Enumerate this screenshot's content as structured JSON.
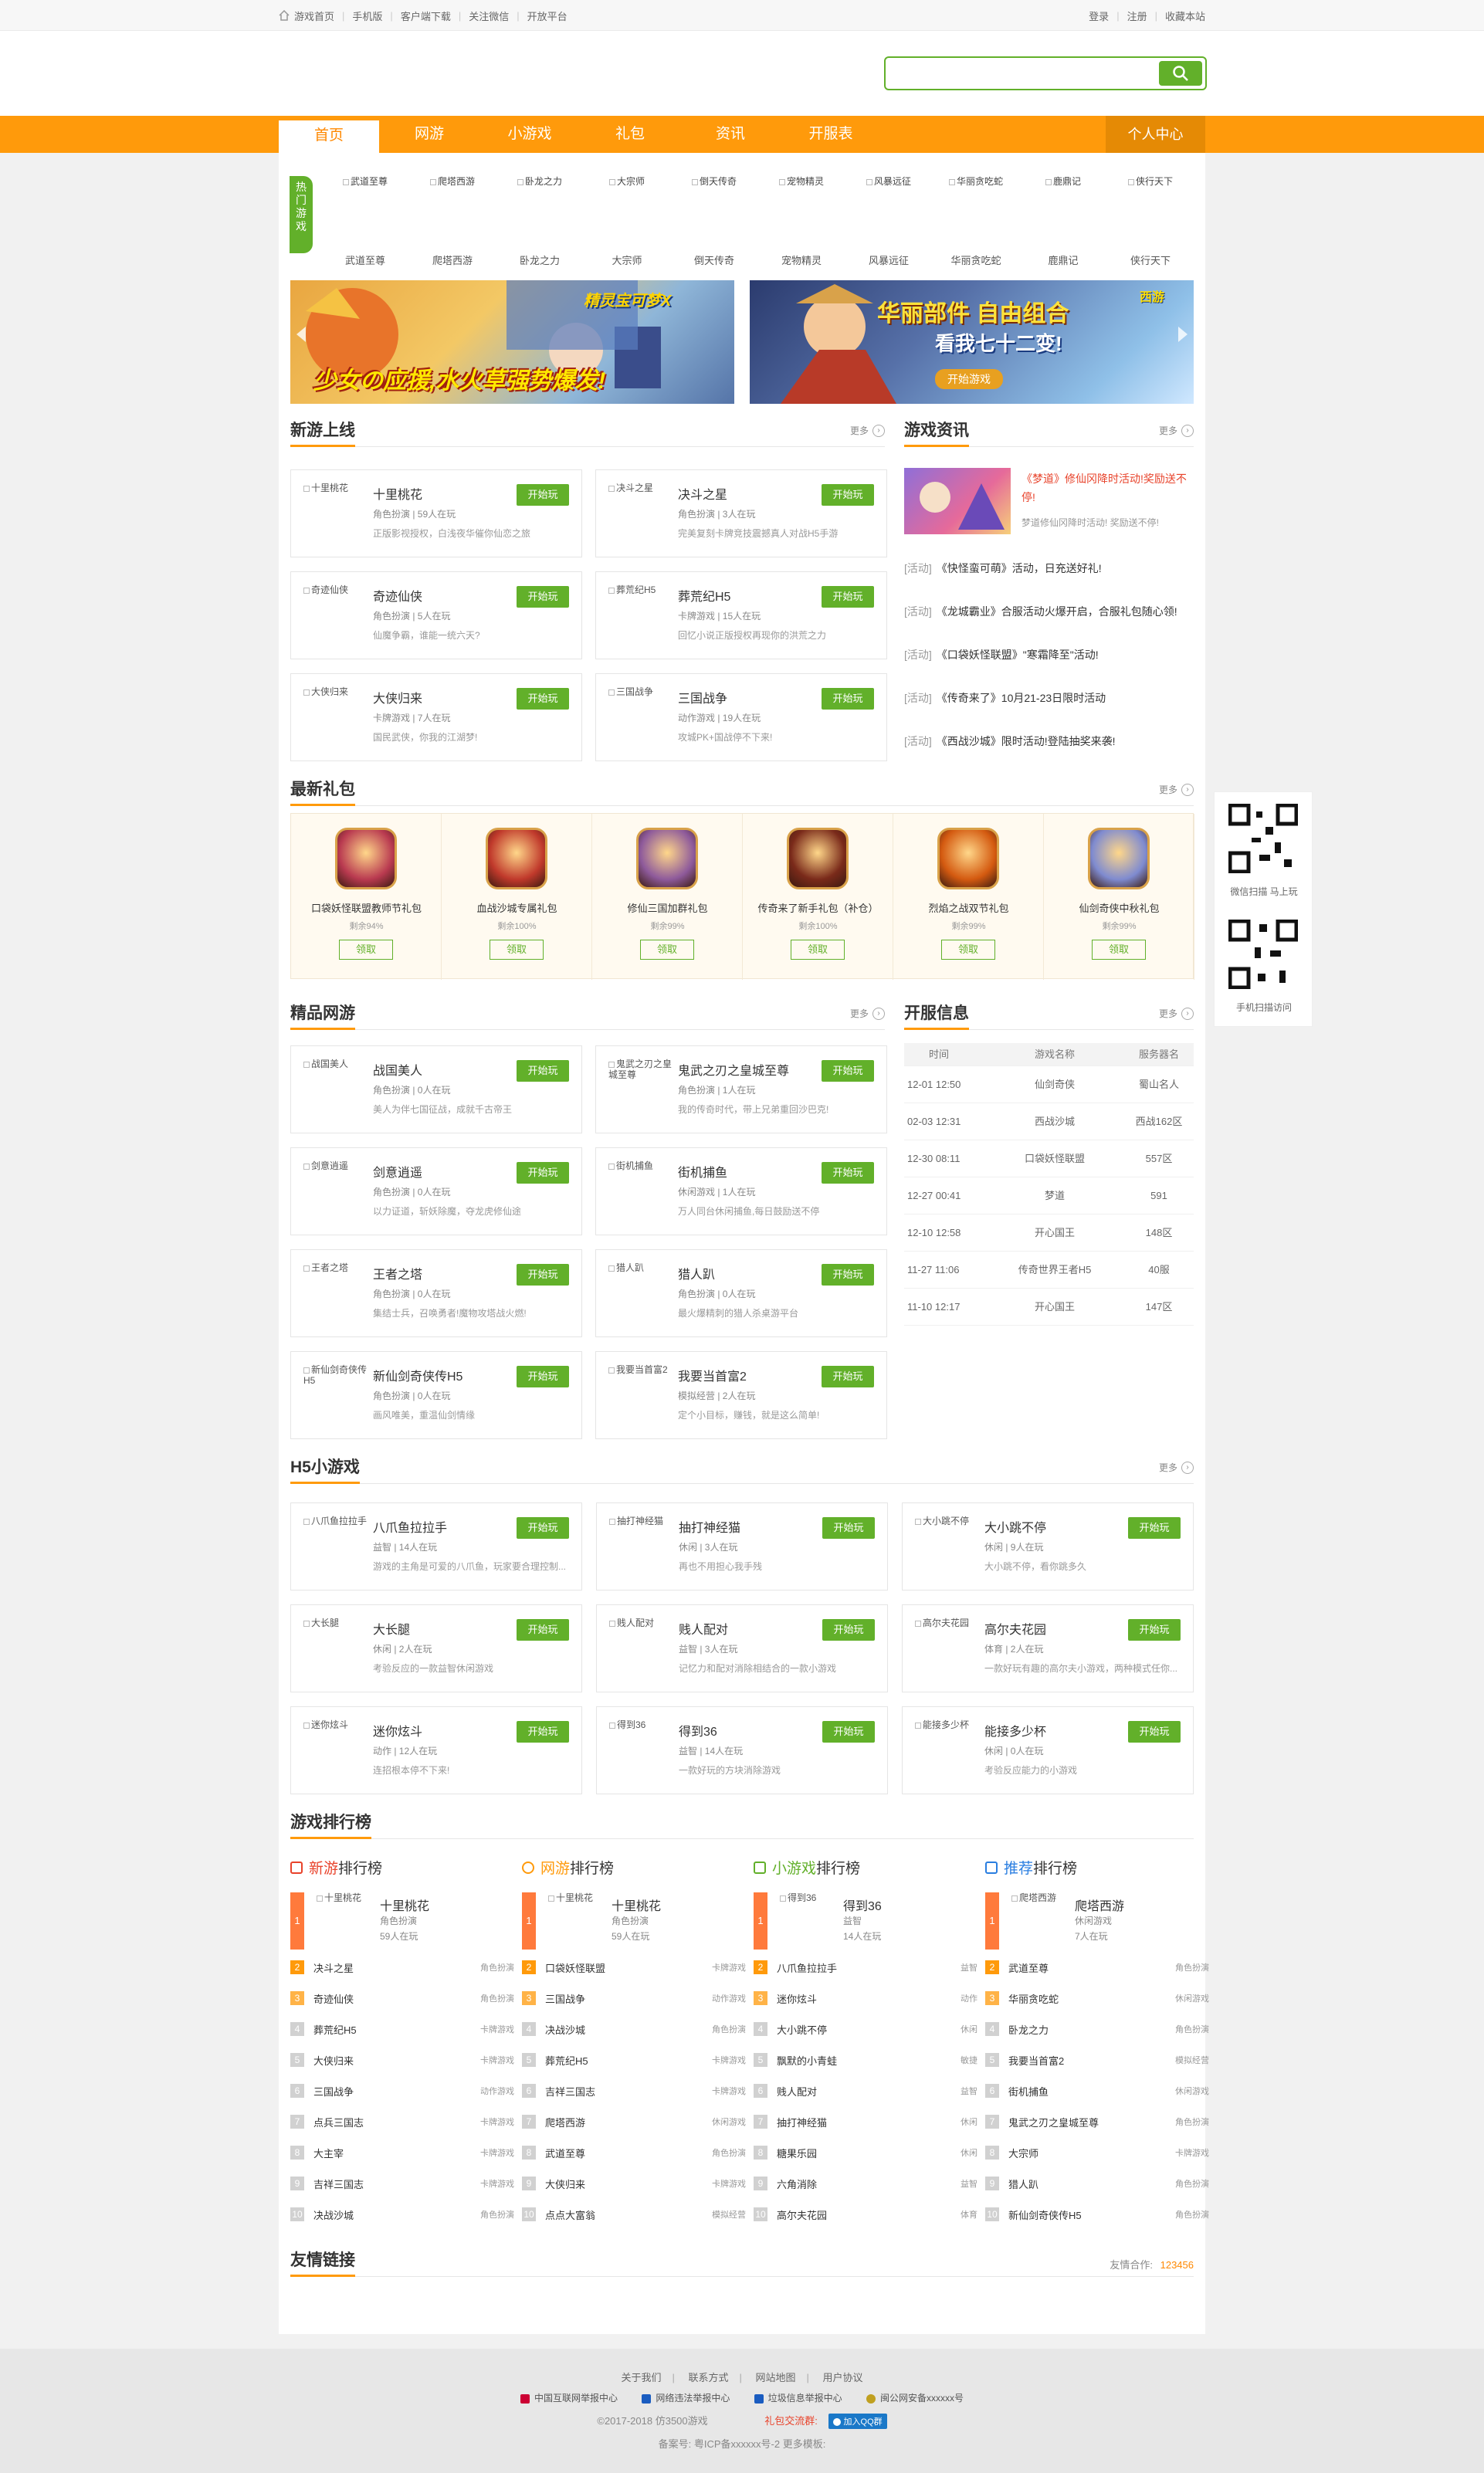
{
  "topbar": {
    "links": [
      "游戏首页",
      "手机版",
      "客户端下载",
      "关注微信",
      "开放平台"
    ],
    "right": [
      "登录",
      "注册",
      "收藏本站"
    ]
  },
  "nav": {
    "items": [
      "首页",
      "网游",
      "小游戏",
      "礼包",
      "资讯",
      "开服表"
    ],
    "user_center": "个人中心"
  },
  "hot": {
    "label": "热门游戏",
    "games": [
      {
        "img": "武道至尊",
        "name": "武道至尊"
      },
      {
        "img": "爬塔西游",
        "name": "爬塔西游"
      },
      {
        "img": "卧龙之力",
        "name": "卧龙之力"
      },
      {
        "img": "大宗师",
        "name": "大宗师"
      },
      {
        "img": "倒天传奇",
        "name": "倒天传奇"
      },
      {
        "img": "宠物精灵",
        "name": "宠物精灵"
      },
      {
        "img": "风暴远征",
        "name": "风暴远征"
      },
      {
        "img": "华丽贪吃蛇",
        "name": "华丽贪吃蛇"
      },
      {
        "img": "鹿鼎记",
        "name": "鹿鼎记"
      },
      {
        "img": "侠行天下",
        "name": "侠行天下"
      }
    ]
  },
  "banners": {
    "left_title": "少女の应援,水火草强势爆发!",
    "left_logo": "精灵宝可梦X",
    "right_title": "华丽部件 自由组合",
    "right_sub": "看我七十二变!",
    "right_btn": "开始游戏",
    "right_logo": "西游"
  },
  "sections": {
    "new_games": "新游上线",
    "news": "游戏资讯",
    "gifts": "最新礼包",
    "boutique": "精品网游",
    "servers": "开服信息",
    "h5": "H5小游戏",
    "ranking": "游戏排行榜",
    "links": "友情链接",
    "more": "更多"
  },
  "play_label": "开始玩",
  "new_games": [
    {
      "img": "十里桃花",
      "name": "十里桃花",
      "meta": "角色扮演 | 59人在玩",
      "desc": "正版影视授权，白浅夜华催你仙恋之旅"
    },
    {
      "img": "决斗之星",
      "name": "决斗之星",
      "meta": "角色扮演 | 3人在玩",
      "desc": "完美复刻卡牌竞技震撼真人对战H5手游"
    },
    {
      "img": "奇迹仙侠",
      "name": "奇迹仙侠",
      "meta": "角色扮演 | 5人在玩",
      "desc": "仙魔争霸，谁能一统六天?"
    },
    {
      "img": "葬荒纪H5",
      "name": "葬荒纪H5",
      "meta": "卡牌游戏 | 15人在玩",
      "desc": "回忆小说正版授权再现你的洪荒之力"
    },
    {
      "img": "大侠归来",
      "name": "大侠归来",
      "meta": "卡牌游戏 | 7人在玩",
      "desc": "国民武侠，你我的江湖梦!"
    },
    {
      "img": "三国战争",
      "name": "三国战争",
      "meta": "动作游戏 | 19人在玩",
      "desc": "攻城PK+国战停不下来!"
    }
  ],
  "news_top": {
    "title": "《梦道》修仙冈降时活动!奖励送不停!",
    "desc": "梦道修仙冈降时活动! 奖励送不停!"
  },
  "news_list": [
    {
      "tag": "[活动]",
      "title": "《快怪蛮可萌》活动，日充送好礼!"
    },
    {
      "tag": "[活动]",
      "title": "《龙城霸业》合服活动火爆开启，合服礼包随心领!"
    },
    {
      "tag": "[活动]",
      "title": "《口袋妖怪联盟》\"寒霜降至\"活动!"
    },
    {
      "tag": "[活动]",
      "title": "《传奇来了》10月21-23日限时活动"
    },
    {
      "tag": "[活动]",
      "title": "《西战沙城》限时活动!登陆抽奖来袭!"
    }
  ],
  "gifts": [
    {
      "name": "口袋妖怪联盟教师节礼包",
      "pct": "剩余94%",
      "btn": "领取",
      "color": "#b93a50"
    },
    {
      "name": "血战沙城专属礼包",
      "pct": "剩余100%",
      "btn": "领取",
      "color": "#c0392b"
    },
    {
      "name": "修仙三国加群礼包",
      "pct": "剩余99%",
      "btn": "领取",
      "color": "#8e5a9b"
    },
    {
      "name": "传奇来了新手礼包（补仓）",
      "pct": "剩余100%",
      "btn": "领取",
      "color": "#7a2a1a"
    },
    {
      "name": "烈焰之战双节礼包",
      "pct": "剩余99%",
      "btn": "领取",
      "color": "#d45a10"
    },
    {
      "name": "仙剑奇侠中秋礼包",
      "pct": "剩余99%",
      "btn": "领取",
      "color": "#7f8bd0"
    }
  ],
  "boutique": [
    {
      "img": "战国美人",
      "name": "战国美人",
      "meta": "角色扮演 | 0人在玩",
      "desc": "美人为伴七国征战，成就千古帝王"
    },
    {
      "img": "鬼武之刃之皇城至尊",
      "name": "鬼武之刃之皇城至尊",
      "meta": "角色扮演 | 1人在玩",
      "desc": "我的传奇时代，带上兄弟重回沙巴克!"
    },
    {
      "img": "剑意逍遥",
      "name": "剑意逍遥",
      "meta": "角色扮演 | 0人在玩",
      "desc": "以力证道，斩妖除魔，夺龙虎修仙途"
    },
    {
      "img": "街机捕鱼",
      "name": "街机捕鱼",
      "meta": "休闲游戏 | 1人在玩",
      "desc": "万人同台休闲捕鱼,每日鼓励送不停"
    },
    {
      "img": "王者之塔",
      "name": "王者之塔",
      "meta": "角色扮演 | 0人在玩",
      "desc": "集结士兵，召唤勇者!魔物攻塔战火燃!"
    },
    {
      "img": "猎人趴",
      "name": "猎人趴",
      "meta": "角色扮演 | 0人在玩",
      "desc": "最火爆精刺的猎人杀桌游平台"
    },
    {
      "img": "新仙剑奇侠传H5",
      "name": "新仙剑奇侠传H5",
      "meta": "角色扮演 | 0人在玩",
      "desc": "画风唯美，重温仙剑情缘"
    },
    {
      "img": "我要当首富2",
      "name": "我要当首富2",
      "meta": "模拟经营 | 2人在玩",
      "desc": "定个小目标，赚钱，就是这么简单!"
    }
  ],
  "servers": {
    "headers": [
      "时间",
      "游戏名称",
      "服务器名"
    ],
    "rows": [
      [
        "12-01 12:50",
        "仙剑奇侠",
        "蜀山名人"
      ],
      [
        "02-03 12:31",
        "西战沙城",
        "西战162区"
      ],
      [
        "12-30 08:11",
        "口袋妖怪联盟",
        "557区"
      ],
      [
        "12-27 00:41",
        "梦道",
        "591"
      ],
      [
        "12-10 12:58",
        "开心国王",
        "148区"
      ],
      [
        "11-27 11:06",
        "传奇世界王者H5",
        "40服"
      ],
      [
        "11-10 12:17",
        "开心国王",
        "147区"
      ]
    ]
  },
  "h5_games": [
    {
      "img": "八爪鱼拉拉手",
      "name": "八爪鱼拉拉手",
      "meta": "益智 | 14人在玩",
      "desc": "游戏的主角是可爱的八爪鱼，玩家要合理控制..."
    },
    {
      "img": "抽打神经猫",
      "name": "抽打神经猫",
      "meta": "休闲 | 3人在玩",
      "desc": "再也不用担心我手残"
    },
    {
      "img": "大小跳不停",
      "name": "大小跳不停",
      "meta": "休闲 | 9人在玩",
      "desc": "大小跳不停，看你跳多久"
    },
    {
      "img": "大长腿",
      "name": "大长腿",
      "meta": "休闲 | 2人在玩",
      "desc": "考验反应的一款益智休闲游戏"
    },
    {
      "img": "贱人配对",
      "name": "贱人配对",
      "meta": "益智 | 3人在玩",
      "desc": "记忆力和配对消除相结合的一款小游戏"
    },
    {
      "img": "高尔夫花园",
      "name": "高尔夫花园",
      "meta": "体育 | 2人在玩",
      "desc": "一款好玩有趣的高尔夫小游戏，两种模式任你..."
    },
    {
      "img": "迷你炫斗",
      "name": "迷你炫斗",
      "meta": "动作 | 12人在玩",
      "desc": "连招根本停不下来!"
    },
    {
      "img": "得到36",
      "name": "得到36",
      "meta": "益智 | 14人在玩",
      "desc": "一款好玩的方块消除游戏"
    },
    {
      "img": "能接多少杯",
      "name": "能接多少杯",
      "meta": "休闲 | 0人在玩",
      "desc": "考验反应能力的小游戏"
    }
  ],
  "ranks": [
    {
      "title_hl": "新游",
      "title": "排行榜",
      "top": {
        "img": "十里桃花",
        "name": "十里桃花",
        "m1": "角色扮演",
        "m2": "59人在玩"
      },
      "list": [
        [
          "决斗之星",
          "角色扮演"
        ],
        [
          "奇迹仙侠",
          "角色扮演"
        ],
        [
          "葬荒纪H5",
          "卡牌游戏"
        ],
        [
          "大侠归来",
          "卡牌游戏"
        ],
        [
          "三国战争",
          "动作游戏"
        ],
        [
          "点兵三国志",
          "卡牌游戏"
        ],
        [
          "大主宰",
          "卡牌游戏"
        ],
        [
          "吉祥三国志",
          "卡牌游戏"
        ],
        [
          "决战沙城",
          "角色扮演"
        ]
      ]
    },
    {
      "title_hl": "网游",
      "title": "排行榜",
      "top": {
        "img": "十里桃花",
        "name": "十里桃花",
        "m1": "角色扮演",
        "m2": "59人在玩"
      },
      "list": [
        [
          "口袋妖怪联盟",
          "卡牌游戏"
        ],
        [
          "三国战争",
          "动作游戏"
        ],
        [
          "决战沙城",
          "角色扮演"
        ],
        [
          "葬荒纪H5",
          "卡牌游戏"
        ],
        [
          "吉祥三国志",
          "卡牌游戏"
        ],
        [
          "爬塔西游",
          "休闲游戏"
        ],
        [
          "武道至尊",
          "角色扮演"
        ],
        [
          "大侠归来",
          "卡牌游戏"
        ],
        [
          "点点大富翁",
          "模拟经营"
        ]
      ]
    },
    {
      "title_hl": "小游戏",
      "title": "排行榜",
      "top": {
        "img": "得到36",
        "name": "得到36",
        "m1": "益智",
        "m2": "14人在玩"
      },
      "list": [
        [
          "八爪鱼拉拉手",
          "益智"
        ],
        [
          "迷你炫斗",
          "动作"
        ],
        [
          "大小跳不停",
          "休闲"
        ],
        [
          "飘默的小青蛙",
          "敏捷"
        ],
        [
          "贱人配对",
          "益智"
        ],
        [
          "抽打神经猫",
          "休闲"
        ],
        [
          "糖果乐园",
          "休闲"
        ],
        [
          "六角消除",
          "益智"
        ],
        [
          "高尔夫花园",
          "体育"
        ]
      ]
    },
    {
      "title_hl": "推荐",
      "title": "排行榜",
      "top": {
        "img": "爬塔西游",
        "name": "爬塔西游",
        "m1": "休闲游戏",
        "m2": "7人在玩"
      },
      "list": [
        [
          "武道至尊",
          "角色扮演"
        ],
        [
          "华丽贪吃蛇",
          "休闲游戏"
        ],
        [
          "卧龙之力",
          "角色扮演"
        ],
        [
          "我要当首富2",
          "模拟经营"
        ],
        [
          "街机捕鱼",
          "休闲游戏"
        ],
        [
          "鬼武之刃之皇城至尊",
          "角色扮演"
        ],
        [
          "大宗师",
          "卡牌游戏"
        ],
        [
          "猎人趴",
          "角色扮演"
        ],
        [
          "新仙剑奇侠传H5",
          "角色扮演"
        ]
      ]
    }
  ],
  "links": {
    "contact_label": "友情合作:",
    "contact_value": "123456"
  },
  "side": {
    "qr1_label": "微信扫描 马上玩",
    "qr2_label": "手机扫描访问"
  },
  "footer": {
    "nav": [
      "关于我们",
      "联系方式",
      "网站地图",
      "用户协议"
    ],
    "badges": [
      "中国互联网举报中心",
      "网络违法举报中心",
      "垃圾信息举报中心",
      "闽公网安备xxxxxx号"
    ],
    "copyright": "©2017-2018   仿3500游戏",
    "group_label": "礼包交流群:",
    "qq_btn": "加入QQ群",
    "icp": "备案号: 粤ICP备xxxxxx号-2     更多模板:"
  },
  "colors": {
    "orange": "#ff9a0b",
    "green": "#62b02a",
    "red": "#e8432b"
  }
}
